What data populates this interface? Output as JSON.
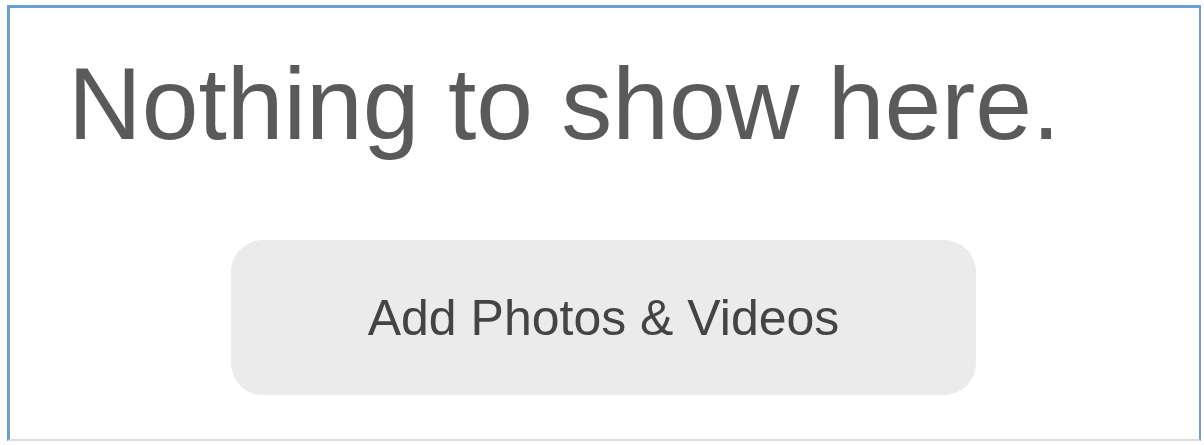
{
  "empty_state": {
    "message": "Nothing to show here.",
    "button": "Add Photos & Videos"
  }
}
